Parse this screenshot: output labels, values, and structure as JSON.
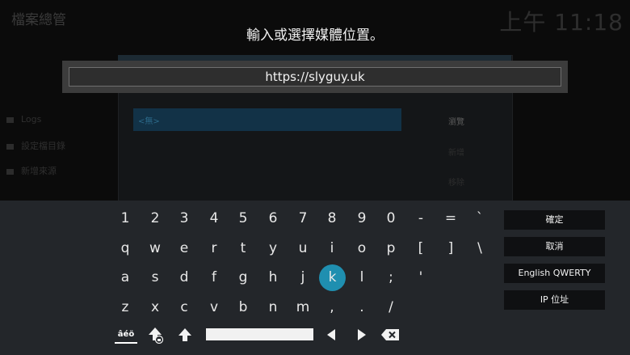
{
  "background": {
    "title": "檔案總管",
    "clock": "上午 11:18",
    "sidebar": [
      {
        "label": "Logs"
      },
      {
        "label": "設定檔目錄"
      },
      {
        "label": "新增來源"
      }
    ],
    "selected_row": "<無>",
    "buttons": [
      "瀏覽",
      "新增",
      "移除"
    ]
  },
  "dialog": {
    "heading": "輸入或選擇媒體位置。",
    "input_value": "https://slyguy.uk"
  },
  "keyboard": {
    "rows": [
      [
        "1",
        "2",
        "3",
        "4",
        "5",
        "6",
        "7",
        "8",
        "9",
        "0",
        "-",
        "=",
        "`"
      ],
      [
        "q",
        "w",
        "e",
        "r",
        "t",
        "y",
        "u",
        "i",
        "o",
        "p",
        "[",
        "]",
        "\\"
      ],
      [
        "a",
        "s",
        "d",
        "f",
        "g",
        "h",
        "j",
        "k",
        "l",
        ";",
        "'"
      ],
      [
        "z",
        "x",
        "c",
        "v",
        "b",
        "n",
        "m",
        ",",
        ".",
        "/"
      ]
    ],
    "selected_key": "k",
    "accent_label": "âéö",
    "icons": [
      "shift-lock-icon",
      "shift-icon",
      "space-bar",
      "arrow-left-icon",
      "arrow-right-icon",
      "backspace-icon"
    ]
  },
  "side_buttons": {
    "confirm": "確定",
    "cancel": "取消",
    "layout": "English QWERTY",
    "ip": "IP 位址"
  },
  "colors": {
    "accent": "#1f8fb0",
    "keyboard_bg": "#23262a",
    "button_bg": "#0f1012"
  }
}
